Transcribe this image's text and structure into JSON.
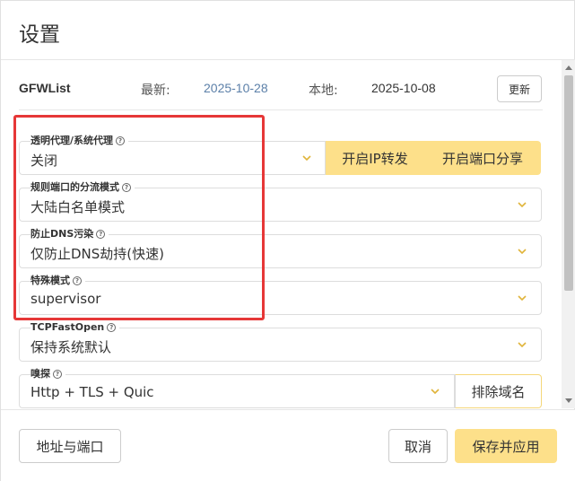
{
  "dialog": {
    "title": "设置"
  },
  "gfwlist": {
    "name": "GFWList",
    "latest_label": "最新:",
    "latest_date": "2025-10-28",
    "local_label": "本地:",
    "local_date": "2025-10-08",
    "update_label": "更新",
    "colors": {
      "latest": "#5b7fa8",
      "local": "#333333"
    }
  },
  "fields": {
    "proxy_mode": {
      "label": "透明代理/系统代理",
      "value": "关闭"
    },
    "routing_mode": {
      "label": "规则端口的分流模式",
      "value": "大陆白名单模式"
    },
    "dns_pollution": {
      "label": "防止DNS污染",
      "value": "仅防止DNS劫持(快速)"
    },
    "special_mode": {
      "label": "特殊模式",
      "value": "supervisor"
    },
    "tcp_fast_open": {
      "label": "TCPFastOpen",
      "value": "保持系统默认"
    },
    "sniffing": {
      "label": "嗅探",
      "value": "Http + TLS + Quic"
    }
  },
  "buttons": {
    "ip_forward": "开启IP转发",
    "port_sharing": "开启端口分享",
    "exclude_domains": "排除域名",
    "address_port": "地址与端口",
    "cancel": "取消",
    "save_apply": "保存并应用"
  },
  "icons": {
    "help": "question-circle-icon",
    "dropdown": "chevron-down-icon"
  },
  "colors": {
    "accent": "#fde08a",
    "highlight_frame": "#e63737"
  }
}
